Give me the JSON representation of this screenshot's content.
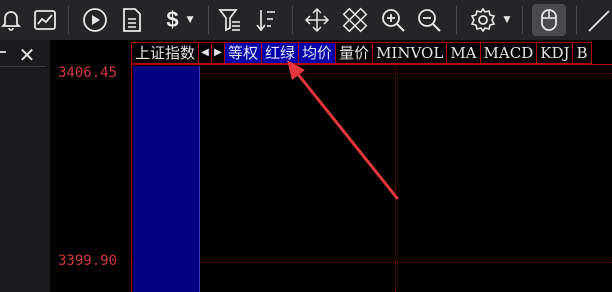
{
  "toolbar": {
    "currency_label": "$",
    "buttons": [
      {
        "name": "bell-icon"
      },
      {
        "name": "chart-icon"
      },
      {
        "name": "play-icon"
      },
      {
        "name": "document-icon"
      },
      {
        "name": "currency-icon"
      },
      {
        "name": "filter-icon"
      },
      {
        "name": "sort-icon"
      },
      {
        "name": "move-icon"
      },
      {
        "name": "crosshair-icon"
      },
      {
        "name": "zoom-in-icon"
      },
      {
        "name": "zoom-out-icon"
      },
      {
        "name": "gear-icon"
      },
      {
        "name": "mouse-icon"
      },
      {
        "name": "line-draw-icon"
      }
    ]
  },
  "sidebar": {
    "close_label": "✕"
  },
  "chart": {
    "price_top": "3406.45",
    "price_bottom": "3399.90",
    "candle_color": "#000080",
    "grid_color": "#7a0000",
    "label_color": "#d2373a"
  },
  "menubar": {
    "items": [
      {
        "label": "上证指数",
        "active": false
      },
      {
        "label": "◀",
        "active": false
      },
      {
        "label": "▶",
        "active": false
      },
      {
        "label": "等权",
        "active": true
      },
      {
        "label": "红绿",
        "active": true
      },
      {
        "label": "均价",
        "active": true
      },
      {
        "label": "量价",
        "active": false
      },
      {
        "label": "MINVOL",
        "active": false
      },
      {
        "label": "MA",
        "active": false
      },
      {
        "label": "MACD",
        "active": false
      },
      {
        "label": "KDJ",
        "active": false
      },
      {
        "label": "B",
        "active": false
      }
    ]
  },
  "annotation": {
    "color": "#e8363e"
  }
}
